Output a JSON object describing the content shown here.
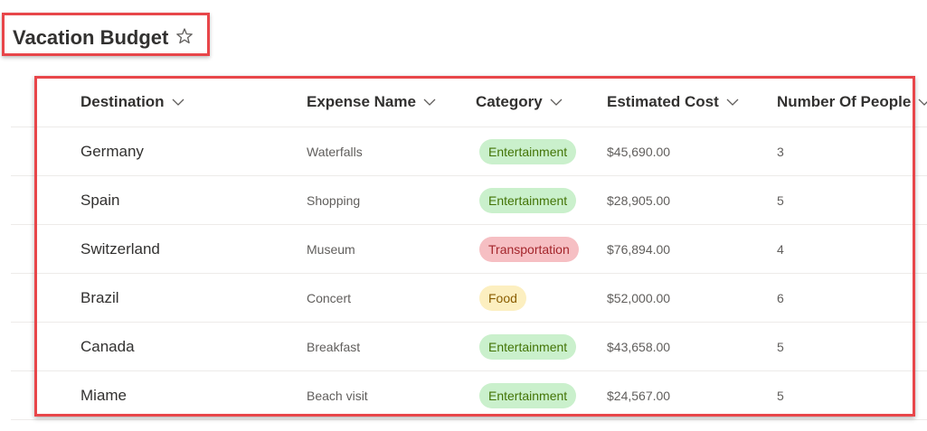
{
  "page": {
    "title": "Vacation Budget",
    "favorite_icon": "star-outline-icon"
  },
  "columns": [
    {
      "label": "Destination",
      "icon": "chevron-down-icon"
    },
    {
      "label": "Expense Name",
      "icon": "chevron-down-icon"
    },
    {
      "label": "Category",
      "icon": "chevron-down-icon"
    },
    {
      "label": "Estimated Cost",
      "icon": "chevron-down-icon"
    },
    {
      "label": "Number Of People",
      "icon": "chevron-down-icon"
    }
  ],
  "rows": [
    {
      "destination": "Germany",
      "expense": "Waterfalls",
      "category": "Entertainment",
      "category_color": "green",
      "cost": "$45,690.00",
      "people": "3"
    },
    {
      "destination": "Spain",
      "expense": "Shopping",
      "category": "Entertainment",
      "category_color": "green",
      "cost": "$28,905.00",
      "people": "5"
    },
    {
      "destination": "Switzerland",
      "expense": "Museum",
      "category": "Transportation",
      "category_color": "red",
      "cost": "$76,894.00",
      "people": "4"
    },
    {
      "destination": "Brazil",
      "expense": "Concert",
      "category": "Food",
      "category_color": "yellow",
      "cost": "$52,000.00",
      "people": "6"
    },
    {
      "destination": "Canada",
      "expense": "Breakfast",
      "category": "Entertainment",
      "category_color": "green",
      "cost": "$43,658.00",
      "people": "5"
    },
    {
      "destination": "Miame",
      "expense": "Beach visit",
      "category": "Entertainment",
      "category_color": "green",
      "cost": "$24,567.00",
      "people": "5"
    }
  ],
  "colors": {
    "highlight_border": "#e8464a",
    "pill_green_bg": "#caf0cc",
    "pill_red_bg": "#f6bfc3",
    "pill_yellow_bg": "#fcefc0"
  }
}
